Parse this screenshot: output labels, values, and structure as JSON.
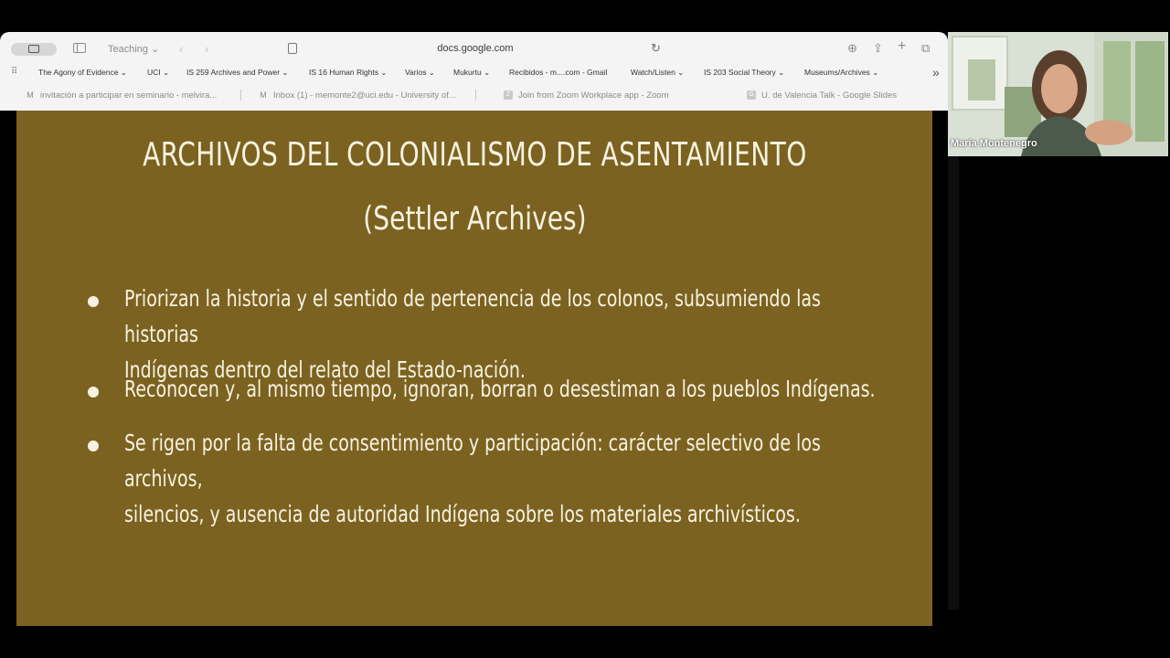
{
  "browser": {
    "tab_group_label": "Teaching ⌄",
    "url": "docs.google.com",
    "bookmarks": [
      "The Agony of Evidence ⌄",
      "UCI ⌄",
      "IS 259 Archives and Power ⌄",
      "IS 16 Human Rights ⌄",
      "Varios ⌄",
      "Mukurtu ⌄",
      "Recibidos - m....com - Gmail",
      "Watch/Listen ⌄",
      "IS 203 Social Theory ⌄",
      "Museums/Archives ⌄"
    ],
    "tabs": [
      {
        "label": "invitación a participar en seminario - melvira...",
        "icon": "gmail-icon"
      },
      {
        "label": "Inbox (1) - memonte2@uci.edu - University of...",
        "icon": "gmail-icon"
      },
      {
        "label": "Join from Zoom Workplace app - Zoom",
        "icon": "zoom-icon"
      },
      {
        "label": "U. de Valencia Talk - Google Slides",
        "icon": "slides-icon"
      }
    ]
  },
  "slide": {
    "title": "ARCHIVOS DEL COLONIALISMO DE ASENTAMIENTO",
    "subtitle": "(Settler Archives)",
    "bullets": [
      {
        "line1": "Priorizan la historia y el sentido de pertenencia de los colonos, subsumiendo las historias",
        "line2": "Indígenas dentro del relato del Estado-nación."
      },
      {
        "line1": "Reconocen y, al mismo tiempo, ignoran, borran o desestiman a los pueblos Indígenas.",
        "line2": ""
      },
      {
        "line1": "Se rigen por la falta de consentimiento y participación: carácter selectivo de los archivos,",
        "line2": "silencios, y ausencia de autoridad Indígena sobre los materiales archivísticos."
      }
    ],
    "background_color": "#7b6220"
  },
  "video": {
    "participant_name": "María Montenegro"
  }
}
